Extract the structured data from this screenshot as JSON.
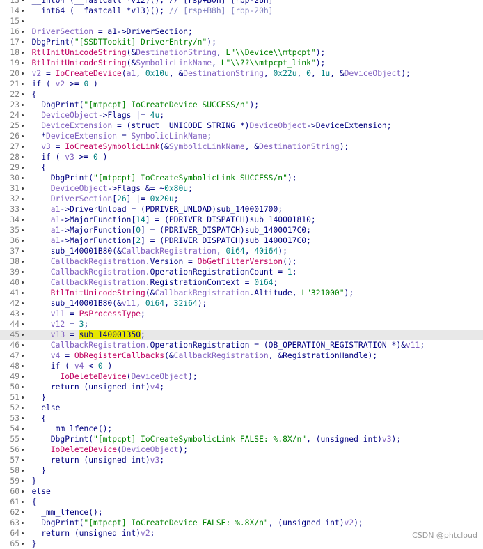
{
  "colors": {
    "default": "#000080",
    "string": "#008000",
    "number": "#008080",
    "variable": "#8060c0",
    "function": "#c00060",
    "comment": "#8080c0",
    "plain": "#000000",
    "highlight": "#e6e600"
  },
  "current_line": 45,
  "watermark": "CSDN @phtcloud",
  "lines": [
    {
      "n": 13,
      "t": [
        [
          "plain",
          "  __int64 (__fastcall *v12)(); // [rsp+B0h] [rbp-28h]"
        ]
      ]
    },
    {
      "n": 14,
      "t": [
        [
          "plain",
          "  __int64 (__fastcall *v13)(); "
        ],
        [
          "comment",
          "// [rsp+B8h] [rbp-20h]"
        ]
      ]
    },
    {
      "n": 15,
      "t": []
    },
    {
      "n": 16,
      "t": [
        [
          "variable",
          "  DriverSection"
        ],
        [
          "plain",
          " = a1->DriverSection;"
        ]
      ]
    },
    {
      "n": 17,
      "t": [
        [
          "plain",
          "  DbgPrint("
        ],
        [
          "string",
          "\"[SSDTTookit] DriverEntry/n\""
        ],
        [
          "plain",
          ");"
        ]
      ]
    },
    {
      "n": 18,
      "t": [
        [
          "function",
          "  RtlInitUnicodeString"
        ],
        [
          "plain",
          "(&"
        ],
        [
          "variable",
          "DestinationString"
        ],
        [
          "plain",
          ", "
        ],
        [
          "string",
          "L\"\\\\Device\\\\mtpcpt\""
        ],
        [
          "plain",
          ");"
        ]
      ]
    },
    {
      "n": 19,
      "t": [
        [
          "function",
          "  RtlInitUnicodeString"
        ],
        [
          "plain",
          "(&"
        ],
        [
          "variable",
          "SymbolicLinkName"
        ],
        [
          "plain",
          ", "
        ],
        [
          "string",
          "L\"\\\\??\\\\mtpcpt_link\""
        ],
        [
          "plain",
          ");"
        ]
      ]
    },
    {
      "n": 20,
      "t": [
        [
          "variable",
          "  v2"
        ],
        [
          "plain",
          " = "
        ],
        [
          "function",
          "IoCreateDevice"
        ],
        [
          "plain",
          "("
        ],
        [
          "variable",
          "a1"
        ],
        [
          "plain",
          ", "
        ],
        [
          "number",
          "0x10u"
        ],
        [
          "plain",
          ", &"
        ],
        [
          "variable",
          "DestinationString"
        ],
        [
          "plain",
          ", "
        ],
        [
          "number",
          "0x22u"
        ],
        [
          "plain",
          ", "
        ],
        [
          "number",
          "0"
        ],
        [
          "plain",
          ", "
        ],
        [
          "number",
          "1u"
        ],
        [
          "plain",
          ", &"
        ],
        [
          "variable",
          "DeviceObject"
        ],
        [
          "plain",
          ");"
        ]
      ]
    },
    {
      "n": 21,
      "t": [
        [
          "plain",
          "  if ( "
        ],
        [
          "variable",
          "v2"
        ],
        [
          "plain",
          " >= "
        ],
        [
          "number",
          "0"
        ],
        [
          "plain",
          " )"
        ]
      ]
    },
    {
      "n": 22,
      "t": [
        [
          "plain",
          "  {"
        ]
      ]
    },
    {
      "n": 23,
      "t": [
        [
          "plain",
          "    DbgPrint("
        ],
        [
          "string",
          "\"[mtpcpt] IoCreateDevice SUCCESS/n\""
        ],
        [
          "plain",
          ");"
        ]
      ]
    },
    {
      "n": 24,
      "t": [
        [
          "variable",
          "    DeviceObject"
        ],
        [
          "plain",
          "->Flags |= "
        ],
        [
          "number",
          "4u"
        ],
        [
          "plain",
          ";"
        ]
      ]
    },
    {
      "n": 25,
      "t": [
        [
          "variable",
          "    DeviceExtension"
        ],
        [
          "plain",
          " = (struct _UNICODE_STRING *)"
        ],
        [
          "variable",
          "DeviceObject"
        ],
        [
          "plain",
          "->DeviceExtension;"
        ]
      ]
    },
    {
      "n": 26,
      "t": [
        [
          "plain",
          "    *"
        ],
        [
          "variable",
          "DeviceExtension"
        ],
        [
          "plain",
          " = "
        ],
        [
          "variable",
          "SymbolicLinkName"
        ],
        [
          "plain",
          ";"
        ]
      ]
    },
    {
      "n": 27,
      "t": [
        [
          "variable",
          "    v3"
        ],
        [
          "plain",
          " = "
        ],
        [
          "function",
          "IoCreateSymbolicLink"
        ],
        [
          "plain",
          "(&"
        ],
        [
          "variable",
          "SymbolicLinkName"
        ],
        [
          "plain",
          ", &"
        ],
        [
          "variable",
          "DestinationString"
        ],
        [
          "plain",
          ");"
        ]
      ]
    },
    {
      "n": 28,
      "t": [
        [
          "plain",
          "    if ( "
        ],
        [
          "variable",
          "v3"
        ],
        [
          "plain",
          " >= "
        ],
        [
          "number",
          "0"
        ],
        [
          "plain",
          " )"
        ]
      ]
    },
    {
      "n": 29,
      "t": [
        [
          "plain",
          "    {"
        ]
      ]
    },
    {
      "n": 30,
      "t": [
        [
          "plain",
          "      DbgPrint("
        ],
        [
          "string",
          "\"[mtpcpt] IoCreateSymbolicLink SUCCESS/n\""
        ],
        [
          "plain",
          ");"
        ]
      ]
    },
    {
      "n": 31,
      "t": [
        [
          "variable",
          "      DeviceObject"
        ],
        [
          "plain",
          "->Flags &= ~"
        ],
        [
          "number",
          "0x80u"
        ],
        [
          "plain",
          ";"
        ]
      ]
    },
    {
      "n": 32,
      "t": [
        [
          "variable",
          "      DriverSection"
        ],
        [
          "plain",
          "["
        ],
        [
          "number",
          "26"
        ],
        [
          "plain",
          "] |= "
        ],
        [
          "number",
          "0x20u"
        ],
        [
          "plain",
          ";"
        ]
      ]
    },
    {
      "n": 33,
      "t": [
        [
          "variable",
          "      a1"
        ],
        [
          "plain",
          "->DriverUnload = (PDRIVER_UNLOAD)sub_140001700;"
        ]
      ]
    },
    {
      "n": 34,
      "t": [
        [
          "variable",
          "      a1"
        ],
        [
          "plain",
          "->MajorFunction["
        ],
        [
          "number",
          "14"
        ],
        [
          "plain",
          "] = (PDRIVER_DISPATCH)sub_140001810;"
        ]
      ]
    },
    {
      "n": 35,
      "t": [
        [
          "variable",
          "      a1"
        ],
        [
          "plain",
          "->MajorFunction["
        ],
        [
          "number",
          "0"
        ],
        [
          "plain",
          "] = (PDRIVER_DISPATCH)sub_1400017C0;"
        ]
      ]
    },
    {
      "n": 36,
      "t": [
        [
          "variable",
          "      a1"
        ],
        [
          "plain",
          "->MajorFunction["
        ],
        [
          "number",
          "2"
        ],
        [
          "plain",
          "] = (PDRIVER_DISPATCH)sub_1400017C0;"
        ]
      ]
    },
    {
      "n": 37,
      "t": [
        [
          "plain",
          "      sub_140001B80(&"
        ],
        [
          "variable",
          "CallbackRegistration"
        ],
        [
          "plain",
          ", "
        ],
        [
          "number",
          "0i64"
        ],
        [
          "plain",
          ", "
        ],
        [
          "number",
          "40i64"
        ],
        [
          "plain",
          ");"
        ]
      ]
    },
    {
      "n": 38,
      "t": [
        [
          "variable",
          "      CallbackRegistration"
        ],
        [
          "plain",
          ".Version = "
        ],
        [
          "function",
          "ObGetFilterVersion"
        ],
        [
          "plain",
          "();"
        ]
      ]
    },
    {
      "n": 39,
      "t": [
        [
          "variable",
          "      CallbackRegistration"
        ],
        [
          "plain",
          ".OperationRegistrationCount = "
        ],
        [
          "number",
          "1"
        ],
        [
          "plain",
          ";"
        ]
      ]
    },
    {
      "n": 40,
      "t": [
        [
          "variable",
          "      CallbackRegistration"
        ],
        [
          "plain",
          ".RegistrationContext = "
        ],
        [
          "number",
          "0i64"
        ],
        [
          "plain",
          ";"
        ]
      ]
    },
    {
      "n": 41,
      "t": [
        [
          "function",
          "      RtlInitUnicodeString"
        ],
        [
          "plain",
          "(&"
        ],
        [
          "variable",
          "CallbackRegistration"
        ],
        [
          "plain",
          ".Altitude, "
        ],
        [
          "string",
          "L\"321000\""
        ],
        [
          "plain",
          ");"
        ]
      ]
    },
    {
      "n": 42,
      "t": [
        [
          "plain",
          "      sub_140001B80(&"
        ],
        [
          "variable",
          "v11"
        ],
        [
          "plain",
          ", "
        ],
        [
          "number",
          "0i64"
        ],
        [
          "plain",
          ", "
        ],
        [
          "number",
          "32i64"
        ],
        [
          "plain",
          ");"
        ]
      ]
    },
    {
      "n": 43,
      "t": [
        [
          "variable",
          "      v11"
        ],
        [
          "plain",
          " = "
        ],
        [
          "function",
          "PsProcessType"
        ],
        [
          "plain",
          ";"
        ]
      ]
    },
    {
      "n": 44,
      "t": [
        [
          "variable",
          "      v12"
        ],
        [
          "plain",
          " = "
        ],
        [
          "number",
          "3"
        ],
        [
          "plain",
          ";"
        ]
      ]
    },
    {
      "n": 45,
      "t": [
        [
          "variable",
          "      v13"
        ],
        [
          "plain",
          " = "
        ],
        [
          "hl",
          "sub_140001350"
        ],
        [
          "plain",
          ";"
        ]
      ]
    },
    {
      "n": 46,
      "t": [
        [
          "variable",
          "      CallbackRegistration"
        ],
        [
          "plain",
          ".OperationRegistration = (OB_OPERATION_REGISTRATION *)&"
        ],
        [
          "variable",
          "v11"
        ],
        [
          "plain",
          ";"
        ]
      ]
    },
    {
      "n": 47,
      "t": [
        [
          "variable",
          "      v4"
        ],
        [
          "plain",
          " = "
        ],
        [
          "function",
          "ObRegisterCallbacks"
        ],
        [
          "plain",
          "(&"
        ],
        [
          "variable",
          "CallbackRegistration"
        ],
        [
          "plain",
          ", &RegistrationHandle);"
        ]
      ]
    },
    {
      "n": 48,
      "t": [
        [
          "plain",
          "      if ( "
        ],
        [
          "variable",
          "v4"
        ],
        [
          "plain",
          " < "
        ],
        [
          "number",
          "0"
        ],
        [
          "plain",
          " )"
        ]
      ]
    },
    {
      "n": 49,
      "t": [
        [
          "function",
          "        IoDeleteDevice"
        ],
        [
          "plain",
          "("
        ],
        [
          "variable",
          "DeviceObject"
        ],
        [
          "plain",
          ");"
        ]
      ]
    },
    {
      "n": 50,
      "t": [
        [
          "plain",
          "      return (unsigned int)"
        ],
        [
          "variable",
          "v4"
        ],
        [
          "plain",
          ";"
        ]
      ]
    },
    {
      "n": 51,
      "t": [
        [
          "plain",
          "    }"
        ]
      ]
    },
    {
      "n": 52,
      "t": [
        [
          "plain",
          "    else"
        ]
      ]
    },
    {
      "n": 53,
      "t": [
        [
          "plain",
          "    {"
        ]
      ]
    },
    {
      "n": 54,
      "t": [
        [
          "plain",
          "      _mm_lfence();"
        ]
      ]
    },
    {
      "n": 55,
      "t": [
        [
          "plain",
          "      DbgPrint("
        ],
        [
          "string",
          "\"[mtpcpt] IoCreateSymbolicLink FALSE: %.8X/n\""
        ],
        [
          "plain",
          ", (unsigned int)"
        ],
        [
          "variable",
          "v3"
        ],
        [
          "plain",
          ");"
        ]
      ]
    },
    {
      "n": 56,
      "t": [
        [
          "function",
          "      IoDeleteDevice"
        ],
        [
          "plain",
          "("
        ],
        [
          "variable",
          "DeviceObject"
        ],
        [
          "plain",
          ");"
        ]
      ]
    },
    {
      "n": 57,
      "t": [
        [
          "plain",
          "      return (unsigned int)"
        ],
        [
          "variable",
          "v3"
        ],
        [
          "plain",
          ";"
        ]
      ]
    },
    {
      "n": 58,
      "t": [
        [
          "plain",
          "    }"
        ]
      ]
    },
    {
      "n": 59,
      "t": [
        [
          "plain",
          "  }"
        ]
      ]
    },
    {
      "n": 60,
      "t": [
        [
          "plain",
          "  else"
        ]
      ]
    },
    {
      "n": 61,
      "t": [
        [
          "plain",
          "  {"
        ]
      ]
    },
    {
      "n": 62,
      "t": [
        [
          "plain",
          "    _mm_lfence();"
        ]
      ]
    },
    {
      "n": 63,
      "t": [
        [
          "plain",
          "    DbgPrint("
        ],
        [
          "string",
          "\"[mtpcpt] IoCreateDevice FALSE: %.8X/n\""
        ],
        [
          "plain",
          ", (unsigned int)"
        ],
        [
          "variable",
          "v2"
        ],
        [
          "plain",
          ");"
        ]
      ]
    },
    {
      "n": 64,
      "t": [
        [
          "plain",
          "    return (unsigned int)"
        ],
        [
          "variable",
          "v2"
        ],
        [
          "plain",
          ";"
        ]
      ]
    },
    {
      "n": 65,
      "t": [
        [
          "plain",
          "  }"
        ]
      ]
    }
  ]
}
